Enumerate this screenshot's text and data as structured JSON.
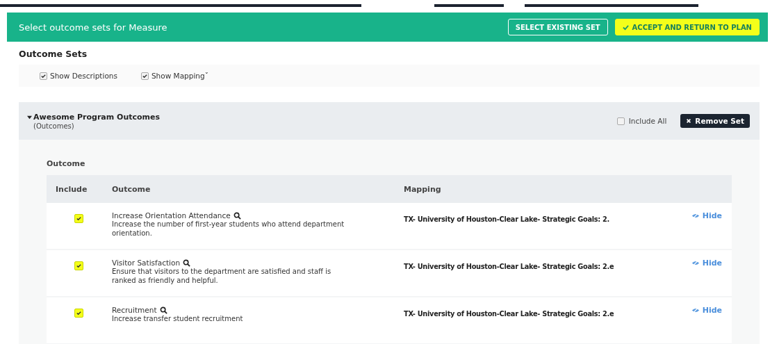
{
  "dialog": {
    "title": "Select outcome sets for Measure",
    "buttons": [
      {
        "label": "SELECT EXISTING SET",
        "kind": "outline",
        "highlighted": false
      },
      {
        "label": "ACCEPT AND RETURN TO PLAN",
        "kind": "primary",
        "highlighted": true
      }
    ]
  },
  "section_title": "Outcome Sets",
  "options": [
    {
      "label": "Show Descriptions",
      "checked": true
    },
    {
      "label": "Show Mappingˇ",
      "checked": true
    }
  ],
  "set": {
    "name": "Awesome Program Outcomes",
    "type": "(Outcomes)",
    "expanded": true,
    "include_all": {
      "label": "Include All",
      "checked": false
    },
    "remove_button": "Remove Set",
    "subheading": "Outcome",
    "columns": [
      "Include",
      "Outcome",
      "Mapping"
    ],
    "rows": [
      {
        "checked": true,
        "highlighted": true,
        "title": "Increase Orientation Attendance",
        "description": "Increase the number of first-year students who attend department orientation.",
        "mapping": "TX- University of Houston-Clear Lake- Strategic Goals: 2.",
        "action": "Hide"
      },
      {
        "checked": true,
        "highlighted": true,
        "title": "Visitor Satisfaction",
        "description": "Ensure that visitors to the department are satisfied and staff is ranked as friendly and helpful.",
        "mapping": "TX- University of Houston-Clear Lake- Strategic Goals: 2.e",
        "action": "Hide"
      },
      {
        "checked": true,
        "highlighted": true,
        "title": "Recruitment",
        "description": "Increase transfer student recruitment",
        "mapping": "TX- University of Houston-Clear Lake- Strategic Goals: 2.e",
        "action": "Hide"
      }
    ]
  }
}
